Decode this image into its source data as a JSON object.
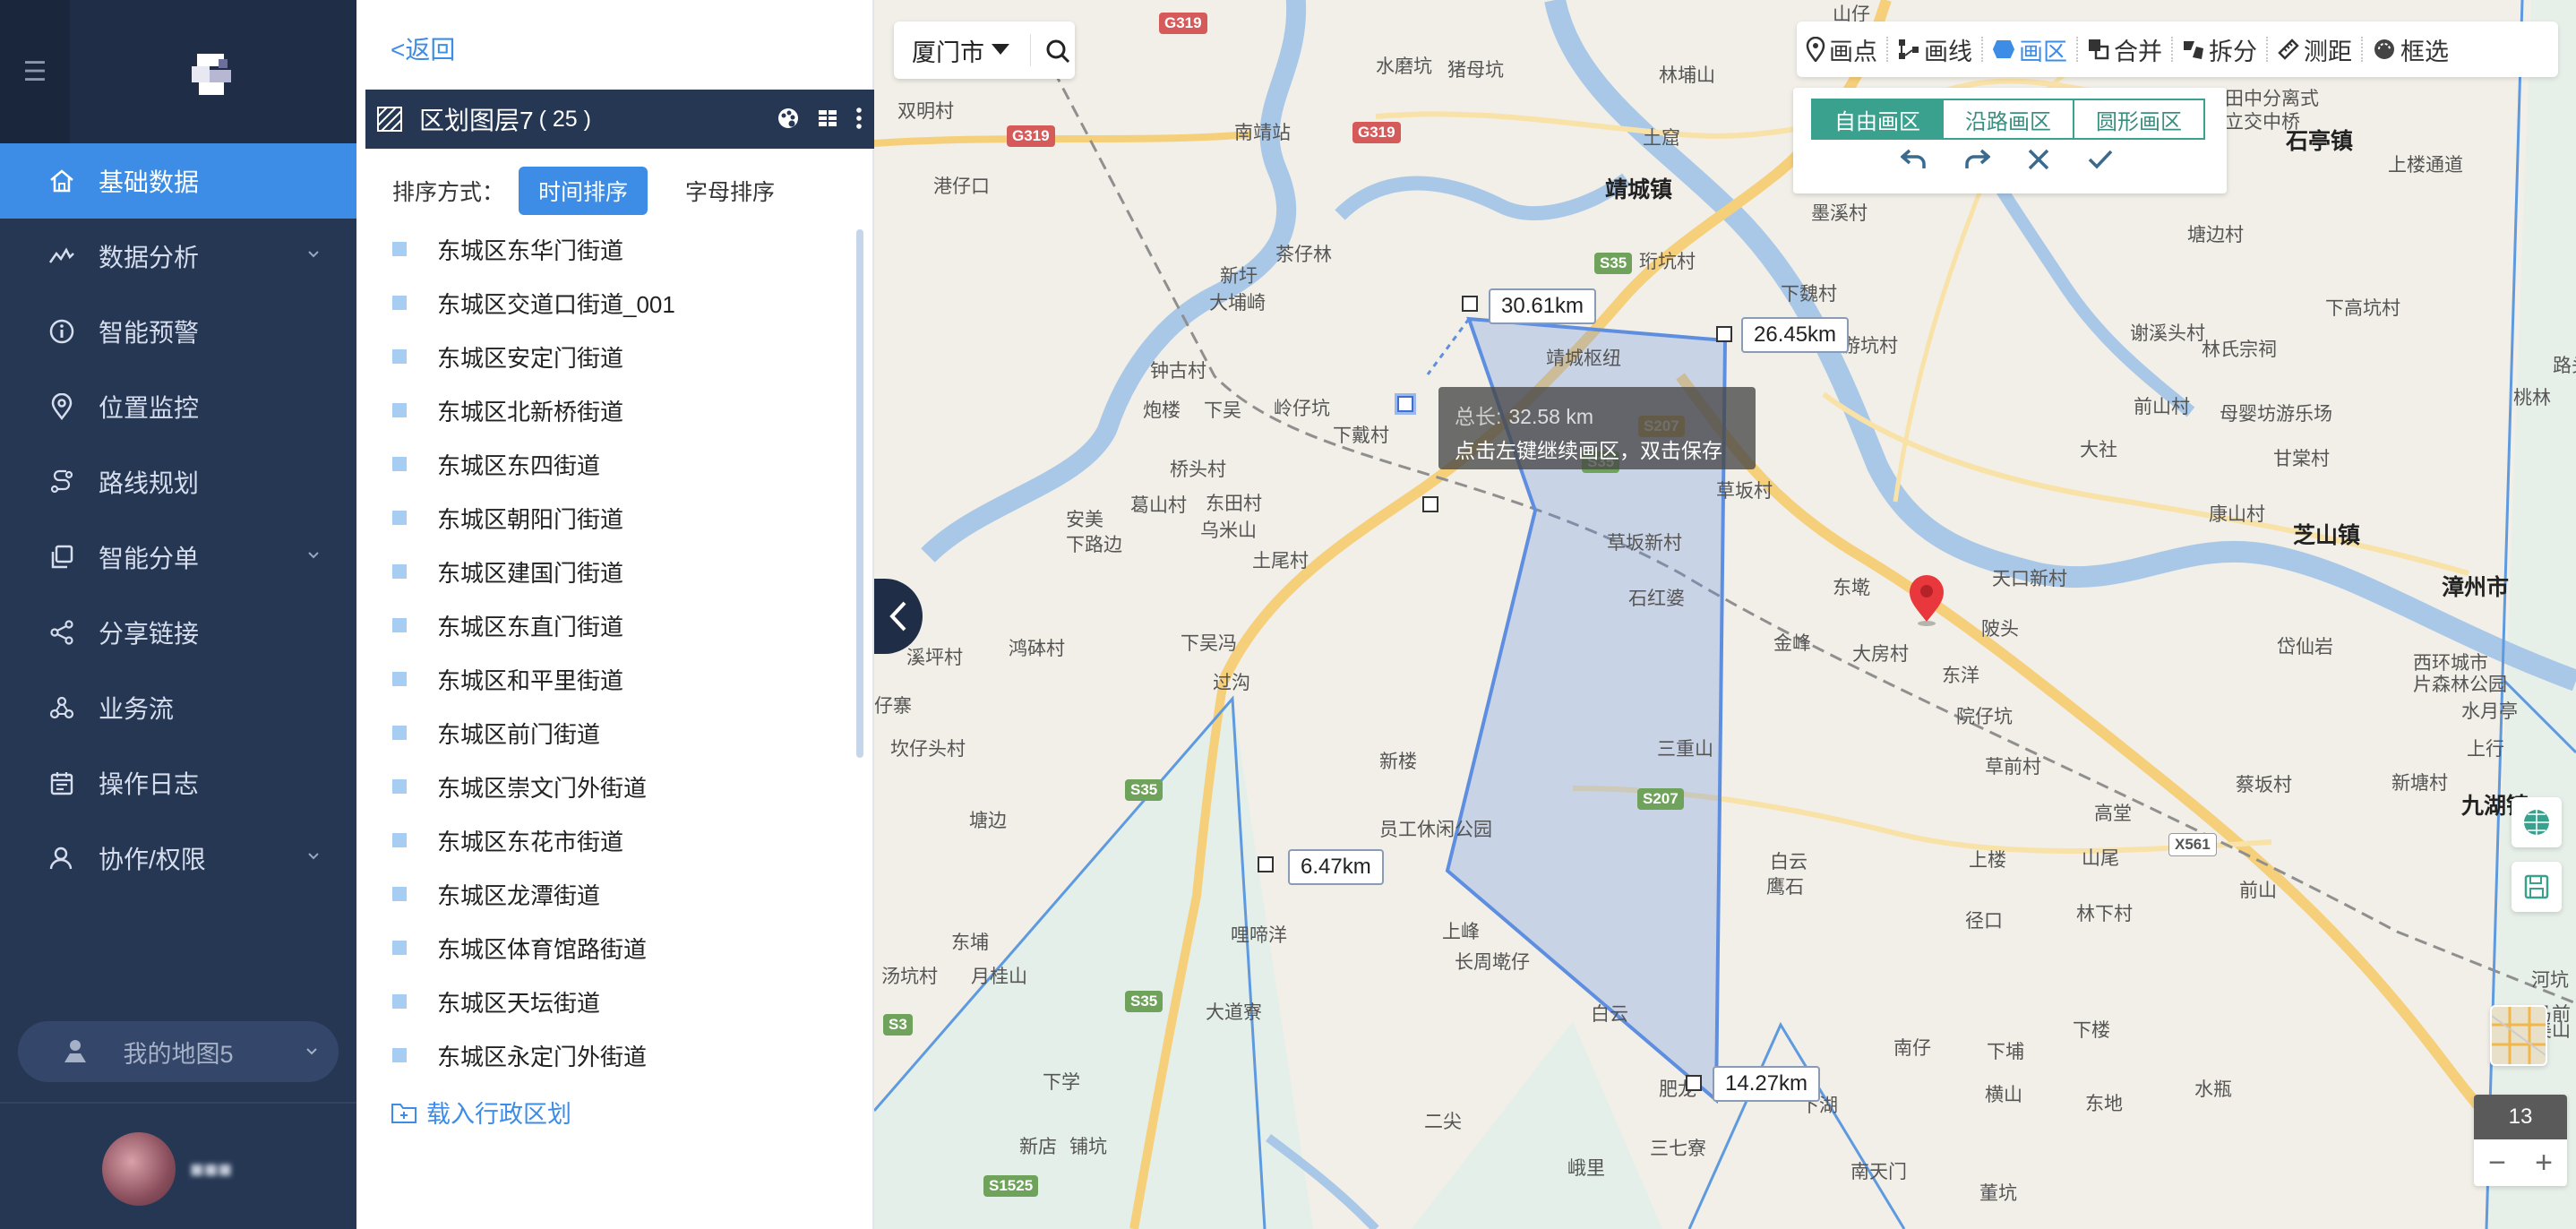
{
  "nav": {
    "items": [
      {
        "label": "基础数据",
        "icon": "home-icon",
        "active": true
      },
      {
        "label": "数据分析",
        "icon": "chart-line-icon",
        "expandable": true
      },
      {
        "label": "智能预警",
        "icon": "info-icon"
      },
      {
        "label": "位置监控",
        "icon": "location-icon"
      },
      {
        "label": "路线规划",
        "icon": "route-icon"
      },
      {
        "label": "智能分单",
        "icon": "copy-icon",
        "expandable": true
      },
      {
        "label": "分享链接",
        "icon": "share-icon"
      },
      {
        "label": "业务流",
        "icon": "workflow-icon"
      },
      {
        "label": "操作日志",
        "icon": "calendar-icon"
      },
      {
        "label": "协作/权限",
        "icon": "user-icon",
        "expandable": true
      }
    ],
    "my_map": "我的地图5"
  },
  "panel": {
    "back": "<返回",
    "layer_name": "区划图层7",
    "layer_count": "( 25 )",
    "sort_label": "排序方式：",
    "sort_time": "时间排序",
    "sort_alpha": "字母排序",
    "regions": [
      "东城区东华门街道",
      "东城区交道口街道_001",
      "东城区安定门街道",
      "东城区北新桥街道",
      "东城区东四街道",
      "东城区朝阳门街道",
      "东城区建国门街道",
      "东城区东直门街道",
      "东城区和平里街道",
      "东城区前门街道",
      "东城区崇文门外街道",
      "东城区东花市街道",
      "东城区龙潭街道",
      "东城区体育馆路街道",
      "东城区天坛街道",
      "东城区永定门外街道"
    ],
    "load_admin": "载入行政区划"
  },
  "map": {
    "city": "厦门市",
    "toolbar": {
      "point": "画点",
      "line": "画线",
      "area": "画区",
      "merge": "合并",
      "split": "拆分",
      "measure": "测距",
      "select": "框选"
    },
    "draw_modes": [
      "自由画区",
      "沿路画区",
      "圆形画区"
    ],
    "distances": {
      "d1": "30.61km",
      "d2": "26.45km",
      "d3": "6.47km",
      "d4": "14.27km"
    },
    "tooltip": {
      "total_label": "总长:",
      "total_value": "32.58 km",
      "hint": "点击左键继续画区，双击保存"
    },
    "zoom": "13",
    "zoom_out": "−",
    "zoom_in": "+",
    "labels": [
      {
        "t": "山仔"
      },
      {
        "t": "双明村"
      },
      {
        "t": "南靖站"
      },
      {
        "t": "水磨坑"
      },
      {
        "t": "猪母坑"
      },
      {
        "t": "林埔山"
      },
      {
        "t": "港仔口"
      },
      {
        "t": "土窟"
      },
      {
        "t": "靖城镇",
        "big": true
      },
      {
        "t": "墨溪村"
      },
      {
        "t": "田中分离式"
      },
      {
        "t": "立交中桥"
      },
      {
        "t": "石亭镇",
        "big": true
      },
      {
        "t": "上楼通道"
      },
      {
        "t": "茶仔林"
      },
      {
        "t": "珩坑村"
      },
      {
        "t": "塘边村"
      },
      {
        "t": "新圩"
      },
      {
        "t": "大埔崎"
      },
      {
        "t": "下魏村"
      },
      {
        "t": "下高坑村"
      },
      {
        "t": "游坑村"
      },
      {
        "t": "谢溪头村"
      },
      {
        "t": "林氏宗祠"
      },
      {
        "t": "钟古村"
      },
      {
        "t": "靖城枢纽"
      },
      {
        "t": "炮楼"
      },
      {
        "t": "下吴"
      },
      {
        "t": "岭仔坑"
      },
      {
        "t": "下戴村"
      },
      {
        "t": "前山村"
      },
      {
        "t": "母婴坊游乐场"
      },
      {
        "t": "桃林"
      },
      {
        "t": "桥头村"
      },
      {
        "t": "葛山村"
      },
      {
        "t": "东田村"
      },
      {
        "t": "草坂村"
      },
      {
        "t": "大社"
      },
      {
        "t": "甘棠村"
      },
      {
        "t": "安美"
      },
      {
        "t": "下路边"
      },
      {
        "t": "乌米山"
      },
      {
        "t": "康山村"
      },
      {
        "t": "芝山镇",
        "big": true
      },
      {
        "t": "土尾村"
      },
      {
        "t": "草坂新村"
      },
      {
        "t": "东墘"
      },
      {
        "t": "天口新村"
      },
      {
        "t": "漳州市",
        "big": true
      },
      {
        "t": "石红婆"
      },
      {
        "t": "金峰"
      },
      {
        "t": "大房村"
      },
      {
        "t": "陂头"
      },
      {
        "t": "岱仙岩"
      },
      {
        "t": "鸿砵村"
      },
      {
        "t": "下吴冯"
      },
      {
        "t": "溪坪村"
      },
      {
        "t": "东洋"
      },
      {
        "t": "西环城市"
      },
      {
        "t": "片森林公园"
      },
      {
        "t": "过沟"
      },
      {
        "t": "仔寨"
      },
      {
        "t": "院仔坑"
      },
      {
        "t": "水月亭"
      },
      {
        "t": "坎仔头村"
      },
      {
        "t": "新楼"
      },
      {
        "t": "三重山"
      },
      {
        "t": "草前村"
      },
      {
        "t": "上行"
      },
      {
        "t": "蔡坂村"
      },
      {
        "t": "新塘村"
      },
      {
        "t": "九湖镇",
        "big": true
      },
      {
        "t": "员工休闲公园"
      },
      {
        "t": "高堂"
      },
      {
        "t": "塘边"
      },
      {
        "t": "白云"
      },
      {
        "t": "上楼"
      },
      {
        "t": "山尾"
      },
      {
        "t": "鹰石"
      },
      {
        "t": "林下村"
      },
      {
        "t": "前山"
      },
      {
        "t": "东埔"
      },
      {
        "t": "哩啼洋"
      },
      {
        "t": "上峰"
      },
      {
        "t": "径口"
      },
      {
        "t": "长周墘仔"
      },
      {
        "t": "汤坑村"
      },
      {
        "t": "月桂山"
      },
      {
        "t": "大道寮"
      },
      {
        "t": "白云"
      },
      {
        "t": "河坑"
      },
      {
        "t": "马前"
      },
      {
        "t": "美山"
      },
      {
        "t": "南仔"
      },
      {
        "t": "下埔"
      },
      {
        "t": "下楼"
      },
      {
        "t": "下学"
      },
      {
        "t": "横山"
      },
      {
        "t": "东地"
      },
      {
        "t": "水瓶"
      },
      {
        "t": "二尖"
      },
      {
        "t": "下湖"
      },
      {
        "t": "新店"
      },
      {
        "t": "铺坑"
      },
      {
        "t": "三七寮"
      },
      {
        "t": "南天门"
      },
      {
        "t": "董坑"
      },
      {
        "t": "峨里"
      },
      {
        "t": "肥龙"
      },
      {
        "t": "路头"
      }
    ],
    "shields": [
      {
        "t": "G319",
        "c": "red"
      },
      {
        "t": "G319",
        "c": "red"
      },
      {
        "t": "G319",
        "c": "red"
      },
      {
        "t": "S35",
        "c": "green"
      },
      {
        "t": "S35",
        "c": "green"
      },
      {
        "t": "S35",
        "c": "green"
      },
      {
        "t": "S35",
        "c": "green"
      },
      {
        "t": "S1525",
        "c": "green"
      },
      {
        "t": "S207",
        "c": "yellow"
      },
      {
        "t": "S207",
        "c": "green"
      },
      {
        "t": "X561",
        "c": "white"
      },
      {
        "t": "S3",
        "c": "green"
      }
    ]
  }
}
